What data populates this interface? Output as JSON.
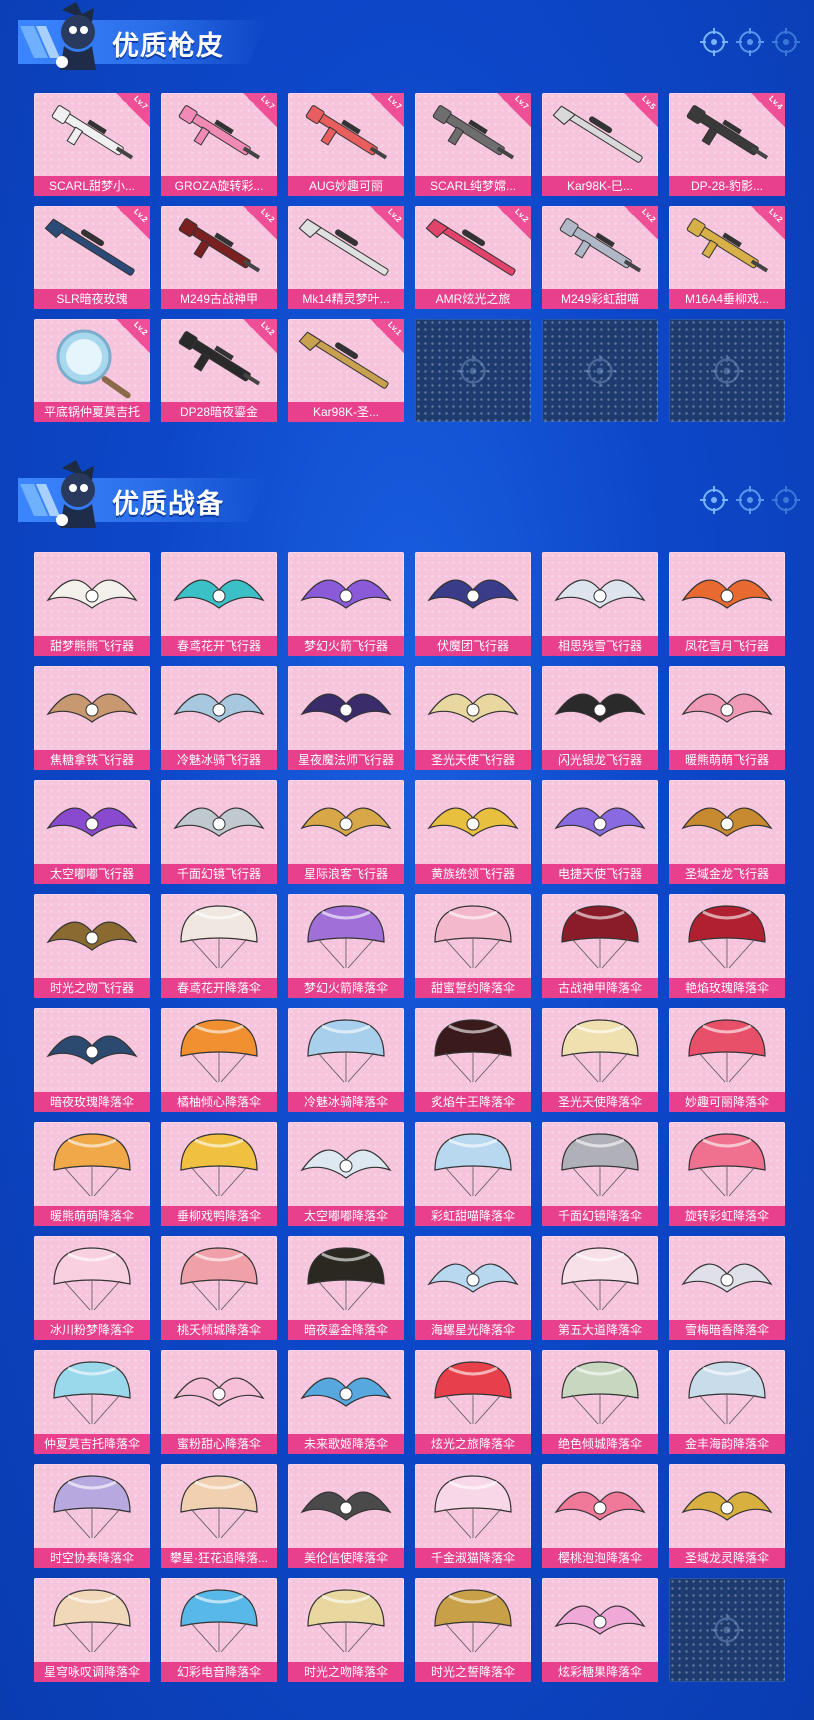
{
  "sections": [
    {
      "title": "优质枪皮",
      "items": [
        {
          "label": "SCARL甜梦小...",
          "level": "Lv.7",
          "kind": "rifle",
          "color": "#f0f0f0"
        },
        {
          "label": "GROZA旋转彩...",
          "level": "Lv.7",
          "kind": "rifle",
          "color": "#f28ab6"
        },
        {
          "label": "AUG妙趣可丽",
          "level": "Lv.7",
          "kind": "rifle",
          "color": "#e85e5e"
        },
        {
          "label": "SCARL纯梦嫦...",
          "level": "Lv.7",
          "kind": "rifle",
          "color": "#6e6e6e"
        },
        {
          "label": "Kar98K-巳...",
          "level": "Lv.5",
          "kind": "sniper",
          "color": "#d9d9d9"
        },
        {
          "label": "DP-28-豹影...",
          "level": "Lv.4",
          "kind": "rifle",
          "color": "#3a3a3a"
        },
        {
          "label": "SLR暗夜玫瑰",
          "level": "Lv.2",
          "kind": "sniper",
          "color": "#2b4a78"
        },
        {
          "label": "M249古战神甲",
          "level": "Lv.2",
          "kind": "rifle",
          "color": "#7a2020"
        },
        {
          "label": "Mk14精灵梦叶...",
          "level": "Lv.2",
          "kind": "sniper",
          "color": "#e0e0e0"
        },
        {
          "label": "AMR炫光之旅",
          "level": "Lv.2",
          "kind": "sniper",
          "color": "#e0446a"
        },
        {
          "label": "M249彩虹甜喵",
          "level": "Lv.2",
          "kind": "rifle",
          "color": "#b0b8c8"
        },
        {
          "label": "M16A4垂柳戏...",
          "level": "Lv.2",
          "kind": "rifle",
          "color": "#d8b048"
        },
        {
          "label": "平底锅仲夏莫吉托",
          "level": "Lv.2",
          "kind": "pan",
          "color": "#a8d8ee"
        },
        {
          "label": "DP28暗夜鎏金",
          "level": "Lv.2",
          "kind": "rifle",
          "color": "#2a2a2a"
        },
        {
          "label": "Kar98K-圣...",
          "level": "Lv.1",
          "kind": "sniper",
          "color": "#c9a050"
        },
        {
          "empty": true
        },
        {
          "empty": true
        },
        {
          "empty": true
        }
      ]
    },
    {
      "title": "优质战备",
      "items": [
        {
          "label": "甜梦熊熊飞行器",
          "kind": "glider",
          "color": "#f4f0ec"
        },
        {
          "label": "春鸢花开飞行器",
          "kind": "glider",
          "color": "#3cc0c8"
        },
        {
          "label": "梦幻火箭飞行器",
          "kind": "glider",
          "color": "#8a5ad8"
        },
        {
          "label": "伏魔团飞行器",
          "kind": "glider",
          "color": "#3a3c8a"
        },
        {
          "label": "相思残雪飞行器",
          "kind": "glider",
          "color": "#dde4ee"
        },
        {
          "label": "凤花雪月飞行器",
          "kind": "glider",
          "color": "#e86a30"
        },
        {
          "label": "焦糖拿铁飞行器",
          "kind": "glider",
          "color": "#c89870"
        },
        {
          "label": "冷魅冰骑飞行器",
          "kind": "glider",
          "color": "#a8c8e0"
        },
        {
          "label": "星夜魔法师飞行器",
          "kind": "glider",
          "color": "#3a2c6a"
        },
        {
          "label": "圣光天使飞行器",
          "kind": "glider",
          "color": "#e8d8a0"
        },
        {
          "label": "闪光银龙飞行器",
          "kind": "glider",
          "color": "#2a2a2a"
        },
        {
          "label": "暖熊萌萌飞行器",
          "kind": "glider",
          "color": "#f09ab8"
        },
        {
          "label": "太空嘟嘟飞行器",
          "kind": "glider",
          "color": "#8a4ad0"
        },
        {
          "label": "千面幻镜飞行器",
          "kind": "glider",
          "color": "#c0c8d0"
        },
        {
          "label": "星际浪客飞行器",
          "kind": "glider",
          "color": "#d8a848"
        },
        {
          "label": "黄族统领飞行器",
          "kind": "glider",
          "color": "#e8c040"
        },
        {
          "label": "电捷天使飞行器",
          "kind": "glider",
          "color": "#8a6ae0"
        },
        {
          "label": "圣域金龙飞行器",
          "kind": "glider",
          "color": "#c88a30"
        },
        {
          "label": "时光之吻飞行器",
          "kind": "glider",
          "color": "#8a6a30"
        },
        {
          "label": "春鸢花开降落伞",
          "kind": "parachute",
          "color": "#f0e8e0"
        },
        {
          "label": "梦幻火箭降落伞",
          "kind": "parachute",
          "color": "#a070d8"
        },
        {
          "label": "甜蜜誓约降落伞",
          "kind": "parachute",
          "color": "#f4b8cc"
        },
        {
          "label": "古战神甲降落伞",
          "kind": "parachute",
          "color": "#8a1c2a"
        },
        {
          "label": "艳焰玫瑰降落伞",
          "kind": "parachute",
          "color": "#b02030"
        },
        {
          "label": "暗夜玫瑰降落伞",
          "kind": "glider",
          "color": "#2c4a70"
        },
        {
          "label": "橘柚倾心降落伞",
          "kind": "parachute",
          "color": "#f09030"
        },
        {
          "label": "冷魅冰骑降落伞",
          "kind": "parachute",
          "color": "#a8d0ec"
        },
        {
          "label": "炙焰牛王降落伞",
          "kind": "parachute",
          "color": "#3a1a1a"
        },
        {
          "label": "圣光天使降落伞",
          "kind": "parachute",
          "color": "#f0e0b0"
        },
        {
          "label": "妙趣可丽降落伞",
          "kind": "parachute",
          "color": "#e8506a"
        },
        {
          "label": "暖熊萌萌降落伞",
          "kind": "parachute",
          "color": "#f0a848"
        },
        {
          "label": "垂柳戏鸭降落伞",
          "kind": "parachute",
          "color": "#f0c040"
        },
        {
          "label": "太空嘟嘟降落伞",
          "kind": "glider",
          "color": "#dde8f0"
        },
        {
          "label": "彩虹甜喵降落伞",
          "kind": "parachute",
          "color": "#b8d8f0"
        },
        {
          "label": "千面幻镜降落伞",
          "kind": "parachute",
          "color": "#b0b0b8"
        },
        {
          "label": "旋转彩虹降落伞",
          "kind": "parachute",
          "color": "#f07090"
        },
        {
          "label": "冰川粉梦降落伞",
          "kind": "parachute",
          "color": "#f8d0e0"
        },
        {
          "label": "桃夭倾城降落伞",
          "kind": "parachute",
          "color": "#f0a0a8"
        },
        {
          "label": "暗夜鎏金降落伞",
          "kind": "parachute",
          "color": "#2a2820"
        },
        {
          "label": "海螺星光降落伞",
          "kind": "glider",
          "color": "#b8d8f0"
        },
        {
          "label": "第五大道降落伞",
          "kind": "parachute",
          "color": "#f8e0e8"
        },
        {
          "label": "雪梅暗香降落伞",
          "kind": "glider",
          "color": "#e0e0e8"
        },
        {
          "label": "仲夏莫吉托降落伞",
          "kind": "parachute",
          "color": "#9ad8ec"
        },
        {
          "label": "蜜粉甜心降落伞",
          "kind": "glider",
          "color": "#f8c0d8"
        },
        {
          "label": "未来歌姬降落伞",
          "kind": "glider",
          "color": "#58a8e0"
        },
        {
          "label": "炫光之旅降落伞",
          "kind": "parachute",
          "color": "#e8404a"
        },
        {
          "label": "绝色倾城降落伞",
          "kind": "parachute",
          "color": "#c8d8c0"
        },
        {
          "label": "金丰海韵降落伞",
          "kind": "parachute",
          "color": "#c8dcea"
        },
        {
          "label": "时空协奏降落伞",
          "kind": "parachute",
          "color": "#b8a8e0"
        },
        {
          "label": "攀星·狂花追降落...",
          "kind": "parachute",
          "color": "#f0d0b0"
        },
        {
          "label": "美伦信使降落伞",
          "kind": "glider",
          "color": "#4a4a4a"
        },
        {
          "label": "千金淑猫降落伞",
          "kind": "parachute",
          "color": "#f8d8e8"
        },
        {
          "label": "樱桃泡泡降落伞",
          "kind": "glider",
          "color": "#f07898"
        },
        {
          "label": "圣域龙灵降落伞",
          "kind": "glider",
          "color": "#d8b040"
        },
        {
          "label": "星穹咏叹调降落伞",
          "kind": "parachute",
          "color": "#f0d8b8"
        },
        {
          "label": "幻彩电音降落伞",
          "kind": "parachute",
          "color": "#58b8e8"
        },
        {
          "label": "时光之吻降落伞",
          "kind": "parachute",
          "color": "#e8d8a0"
        },
        {
          "label": "时光之誓降落伞",
          "kind": "parachute",
          "color": "#c8a048"
        },
        {
          "label": "炫彩糖果降落伞",
          "kind": "glider",
          "color": "#f0a8d8"
        },
        {
          "empty": true
        }
      ]
    }
  ]
}
